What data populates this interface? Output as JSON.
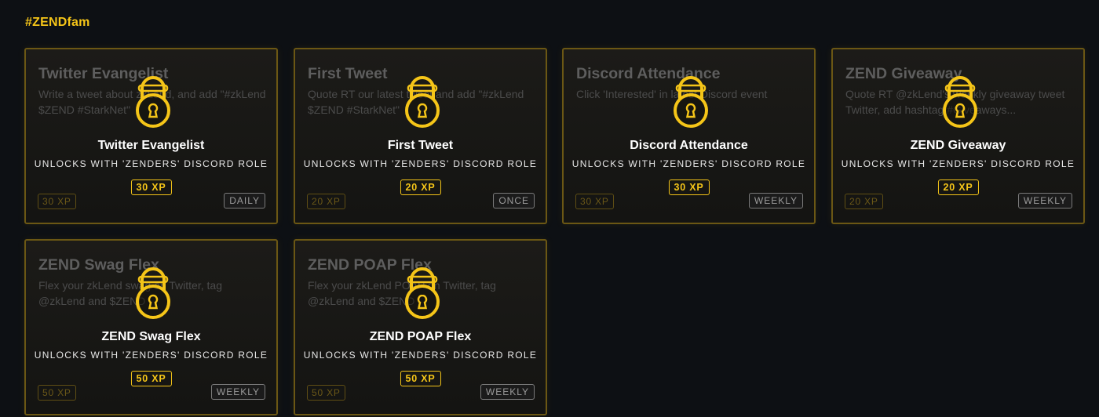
{
  "section": {
    "heading": "#ZENDfam"
  },
  "colors": {
    "accent": "#f5c518",
    "background": "#0d1014"
  },
  "cards": [
    {
      "bg_title": "Twitter Evangelist",
      "bg_desc": "Write a tweet about zkLend, and add \"#zkLend $ZEND #StarkNet\"",
      "title": "Twitter Evangelist",
      "unlock": "UNLOCKS WITH 'ZENDERS' DISCORD ROLE",
      "xp": "30 XP",
      "xp_faded": "30 XP",
      "frequency": "DAILY",
      "icon": "padlock-icon"
    },
    {
      "bg_title": "First Tweet",
      "bg_desc": "Quote RT our latest tweet and add \"#zkLend $ZEND #StarkNet\"",
      "title": "First Tweet",
      "unlock": "UNLOCKS WITH 'ZENDERS' DISCORD ROLE",
      "xp": "20 XP",
      "xp_faded": "20 XP",
      "frequency": "ONCE",
      "icon": "padlock-icon"
    },
    {
      "bg_title": "Discord Attendance",
      "bg_desc": "Click 'Interested' in latest Discord event",
      "title": "Discord Attendance",
      "unlock": "UNLOCKS WITH 'ZENDERS' DISCORD ROLE",
      "xp": "30 XP",
      "xp_faded": "30 XP",
      "frequency": "WEEKLY",
      "icon": "padlock-icon"
    },
    {
      "bg_title": "ZEND Giveaway",
      "bg_desc": "Quote RT @zkLend's weekly giveaway tweet Twitter, add hashtag #Giveaways...",
      "title": "ZEND Giveaway",
      "unlock": "UNLOCKS WITH 'ZENDERS' DISCORD ROLE",
      "xp": "20 XP",
      "xp_faded": "20 XP",
      "frequency": "WEEKLY",
      "icon": "padlock-icon"
    },
    {
      "bg_title": "ZEND Swag Flex",
      "bg_desc": "Flex your zkLend swag on Twitter, tag @zkLend and $ZEND",
      "title": "ZEND Swag Flex",
      "unlock": "UNLOCKS WITH 'ZENDERS' DISCORD ROLE",
      "xp": "50 XP",
      "xp_faded": "50 XP",
      "frequency": "WEEKLY",
      "icon": "padlock-icon"
    },
    {
      "bg_title": "ZEND POAP Flex",
      "bg_desc": "Flex your zkLend POAP on Twitter, tag @zkLend and $ZEND",
      "title": "ZEND POAP Flex",
      "unlock": "UNLOCKS WITH 'ZENDERS' DISCORD ROLE",
      "xp": "50 XP",
      "xp_faded": "50 XP",
      "frequency": "WEEKLY",
      "icon": "padlock-icon"
    }
  ]
}
